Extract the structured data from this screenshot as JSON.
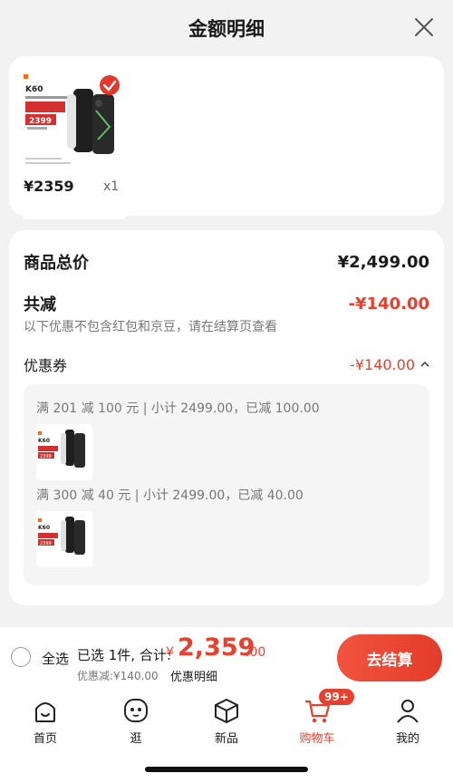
{
  "header": {
    "title": "金额明细"
  },
  "product": {
    "price": "¥2359",
    "qty": "x1"
  },
  "summary": {
    "total_label": "商品总价",
    "total_value": "¥2,499.00",
    "reduce_label": "共减",
    "reduce_value": "-¥140.00",
    "note": "以下优惠不包含红包和京豆，请在结算页查看",
    "coupon_label": "优惠券",
    "coupon_value": "-¥140.00",
    "coupon_lines": [
      "满 201 减 100 元 | 小计 2499.00，已减 100.00",
      "满 300 减 40 元 | 小计 2499.00，已减 40.00"
    ]
  },
  "bottom": {
    "select_all": "全选",
    "selected_text": "已选 1件, 合计:",
    "total_yen": "¥",
    "total_int": "2,359",
    "total_dec": ".00",
    "discount": "优惠减:¥140.00",
    "detail_link": "优惠明细",
    "checkout": "去结算"
  },
  "tabs": {
    "home": "首页",
    "browse": "逛",
    "new": "新品",
    "cart": "购物车",
    "me": "我的",
    "cart_badge": "99+"
  },
  "colors": {
    "accent": "#e8402f"
  }
}
